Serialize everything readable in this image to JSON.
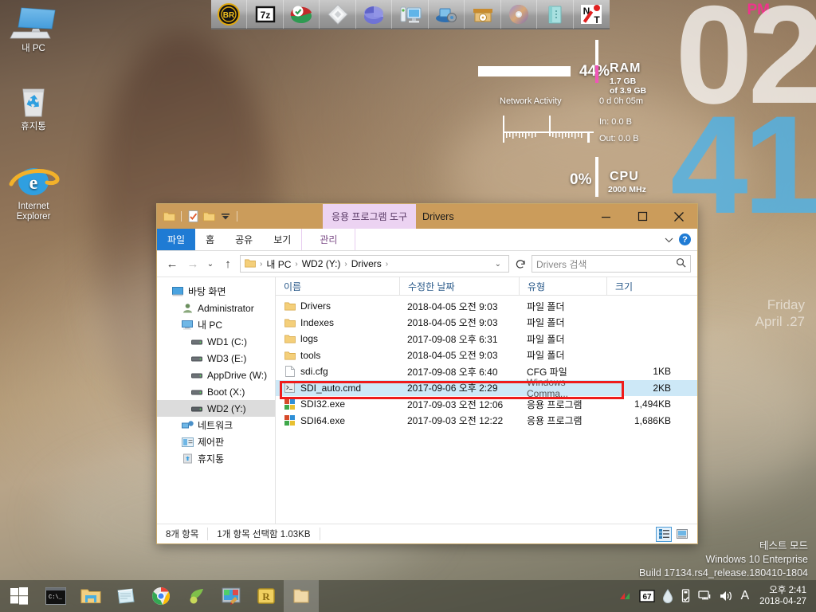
{
  "desktop": {
    "icons": [
      {
        "label": "내 PC",
        "icon": "my-computer-icon"
      },
      {
        "label": "휴지통",
        "icon": "recycle-bin-icon"
      },
      {
        "label": "Internet\nExplorer",
        "label_line1": "Internet",
        "label_line2": "Explorer",
        "icon": "internet-explorer-icon"
      }
    ]
  },
  "app_launcher": {
    "items": [
      {
        "name": "br-icon",
        "label": "BR"
      },
      {
        "name": "7zip-icon",
        "label": "7z"
      },
      {
        "name": "partition-tool-icon",
        "label": ""
      },
      {
        "name": "diskette-tool-icon",
        "label": ""
      },
      {
        "name": "disk-chart-icon",
        "label": ""
      },
      {
        "name": "system-monitor-icon",
        "label": ""
      },
      {
        "name": "network-settings-icon",
        "label": ""
      },
      {
        "name": "archive-box-icon",
        "label": ""
      },
      {
        "name": "cd-disc-icon",
        "label": ""
      },
      {
        "name": "notes-icon",
        "label": ""
      },
      {
        "name": "nt-tool-icon",
        "label": "NT"
      }
    ]
  },
  "gadget": {
    "ram": {
      "percent": "44%",
      "title": "RAM",
      "used": "1.7 GB",
      "total": "of 3.9 GB",
      "fill_percent": 44
    },
    "network": {
      "title": "Network Activity",
      "uptime": "0 d 0h 05m",
      "in": "In: 0.0 B",
      "out": "Out: 0.0 B"
    },
    "cpu": {
      "percent": "0%",
      "title": "CPU",
      "speed": "2000 MHz"
    }
  },
  "clock_gadget": {
    "ampm": "PM",
    "hours": "02",
    "minutes": "41",
    "weekday": "Friday",
    "date": "April .27"
  },
  "explorer": {
    "title": "Drivers",
    "contextual_tab": "응용 프로그램 도구",
    "quick_access": [
      {
        "name": "folder-icon"
      },
      {
        "name": "properties-icon"
      },
      {
        "name": "new-folder-icon"
      },
      {
        "name": "customize-dropdown-icon"
      }
    ],
    "window_buttons": [
      {
        "name": "minimize-button",
        "glyph": "—"
      },
      {
        "name": "maximize-button",
        "glyph": "□"
      },
      {
        "name": "close-button",
        "glyph": "✕"
      }
    ],
    "ribbon_tabs": [
      {
        "label": "파일",
        "state": "active"
      },
      {
        "label": "홈",
        "state": "normal"
      },
      {
        "label": "공유",
        "state": "normal"
      },
      {
        "label": "보기",
        "state": "normal"
      },
      {
        "label": "관리",
        "state": "contextual"
      }
    ],
    "ribbon_right": {
      "collapse_icon": "chevron-down-icon",
      "help_label": "?"
    },
    "nav_buttons": {
      "back": "←",
      "forward": "→",
      "recent": "⌄",
      "up": "↑"
    },
    "breadcrumb": {
      "root_icon": "folder-icon",
      "segments": [
        "내 PC",
        "WD2 (Y:)",
        "Drivers"
      ],
      "dropdown_icon": "chevron-down-icon",
      "refresh_icon": "refresh-icon"
    },
    "search": {
      "placeholder": "Drivers 검색",
      "value": "",
      "icon": "search-icon"
    },
    "nav_tree": [
      {
        "label": "바탕 화면",
        "icon": "desktop-icon",
        "indent": 0,
        "selected": false
      },
      {
        "label": "Administrator",
        "icon": "user-icon",
        "indent": 1,
        "selected": false
      },
      {
        "label": "내 PC",
        "icon": "computer-icon",
        "indent": 1,
        "selected": false
      },
      {
        "label": "WD1 (C:)",
        "icon": "drive-icon",
        "indent": 2,
        "selected": false
      },
      {
        "label": "WD3 (E:)",
        "icon": "drive-icon",
        "indent": 2,
        "selected": false
      },
      {
        "label": "AppDrive (W:)",
        "icon": "drive-icon",
        "indent": 2,
        "selected": false
      },
      {
        "label": "Boot (X:)",
        "icon": "drive-icon",
        "indent": 2,
        "selected": false
      },
      {
        "label": "WD2 (Y:)",
        "icon": "drive-icon",
        "indent": 2,
        "selected": true
      },
      {
        "label": "네트워크",
        "icon": "network-icon",
        "indent": 1,
        "selected": false
      },
      {
        "label": "제어판",
        "icon": "control-panel-icon",
        "indent": 1,
        "selected": false
      },
      {
        "label": "휴지통",
        "icon": "recycle-bin-icon",
        "indent": 1,
        "selected": false
      }
    ],
    "columns": [
      {
        "label": "이름",
        "key": "name"
      },
      {
        "label": "수정한 날짜",
        "key": "date"
      },
      {
        "label": "유형",
        "key": "type"
      },
      {
        "label": "크기",
        "key": "size"
      }
    ],
    "sort": {
      "column": "이름",
      "direction": "asc",
      "marker": "⌃"
    },
    "files": [
      {
        "name": "Drivers",
        "date": "2018-04-05 오전 9:03",
        "type": "파일 폴더",
        "size": "",
        "icon": "folder-icon",
        "selected": false
      },
      {
        "name": "Indexes",
        "date": "2018-04-05 오전 9:03",
        "type": "파일 폴더",
        "size": "",
        "icon": "folder-icon",
        "selected": false
      },
      {
        "name": "logs",
        "date": "2017-09-08 오후 6:31",
        "type": "파일 폴더",
        "size": "",
        "icon": "folder-icon",
        "selected": false
      },
      {
        "name": "tools",
        "date": "2018-04-05 오전 9:03",
        "type": "파일 폴더",
        "size": "",
        "icon": "folder-icon",
        "selected": false
      },
      {
        "name": "sdi.cfg",
        "date": "2017-09-08 오후 6:40",
        "type": "CFG 파일",
        "size": "1KB",
        "icon": "file-icon",
        "selected": false
      },
      {
        "name": "SDI_auto.cmd",
        "date": "2017-09-06 오후 2:29",
        "type": "Windows Comma...",
        "size": "2KB",
        "icon": "cmd-icon",
        "selected": true
      },
      {
        "name": "SDI32.exe",
        "date": "2017-09-03 오전 12:06",
        "type": "응용 프로그램",
        "size": "1,494KB",
        "icon": "exe-icon",
        "selected": false
      },
      {
        "name": "SDI64.exe",
        "date": "2017-09-03 오전 12:22",
        "type": "응용 프로그램",
        "size": "1,686KB",
        "icon": "exe-icon",
        "selected": false
      }
    ],
    "highlight": {
      "color": "#ef1b1b",
      "target": "SDI_auto.cmd"
    },
    "status": {
      "item_count": "8개 항목",
      "selection": "1개 항목 선택함 1.03KB"
    },
    "view_buttons": [
      {
        "name": "details-view-button",
        "active": true
      },
      {
        "name": "large-icons-view-button",
        "active": false
      }
    ]
  },
  "system_info": {
    "line1": "테스트 모드",
    "line2": "Windows 10 Enterprise",
    "line3": "Build 17134.rs4_release.180410-1804"
  },
  "taskbar": {
    "start": {
      "name": "start-button"
    },
    "items": [
      {
        "name": "taskbar-command-prompt",
        "active": false
      },
      {
        "name": "taskbar-file-explorer",
        "active": false
      },
      {
        "name": "taskbar-notepad",
        "active": false
      },
      {
        "name": "taskbar-chrome",
        "active": false
      },
      {
        "name": "taskbar-leaf-app",
        "active": false
      },
      {
        "name": "taskbar-paint",
        "active": false
      },
      {
        "name": "taskbar-r-app",
        "active": false
      },
      {
        "name": "taskbar-explorer-window",
        "active": true
      }
    ],
    "tray": [
      {
        "name": "tray-show-hidden-icon"
      },
      {
        "name": "tray-speccy-icon",
        "label": "67"
      },
      {
        "name": "tray-water-drop-icon"
      },
      {
        "name": "tray-usb-icon"
      },
      {
        "name": "tray-network-icon"
      },
      {
        "name": "tray-volume-icon"
      },
      {
        "name": "tray-ime-icon",
        "label": "A"
      }
    ],
    "clock": {
      "time": "오후 2:41",
      "date": "2018-04-27"
    }
  },
  "colors": {
    "titlebar": "#cb9c5b",
    "ribbon_active": "#1f7bd4",
    "contextual_tab": "#ecd3f2",
    "selection": "#cde8f7",
    "highlight_red": "#ef1b1b",
    "clock_minutes": "#4fb2e6",
    "clock_ampm": "#f0338c"
  }
}
